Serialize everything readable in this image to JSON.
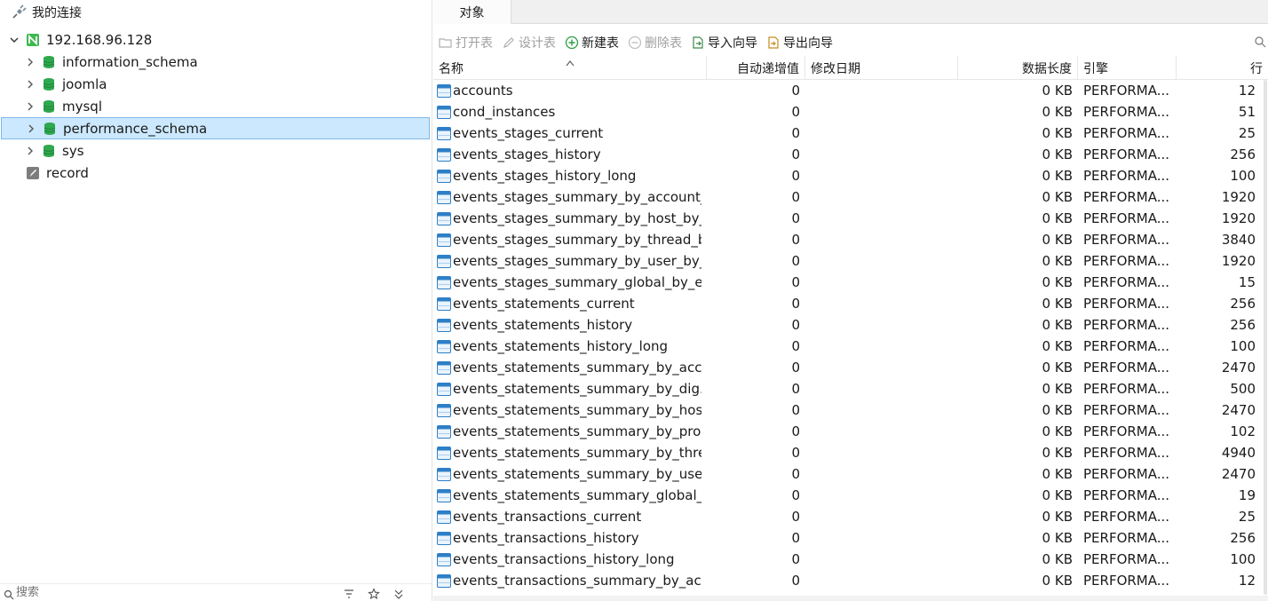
{
  "navigator": {
    "title": "我的连接",
    "connection": {
      "label": "192.168.96.128"
    },
    "databases": [
      {
        "label": "information_schema"
      },
      {
        "label": "joomla"
      },
      {
        "label": "mysql"
      },
      {
        "label": "performance_schema",
        "selected": true
      },
      {
        "label": "sys"
      }
    ],
    "other": {
      "label": "record"
    },
    "search": {
      "placeholder": "搜索"
    }
  },
  "tabs": [
    {
      "label": "对象"
    }
  ],
  "toolbar": {
    "open_table": "打开表",
    "design_table": "设计表",
    "new_table": "新建表",
    "delete_table": "删除表",
    "import_wizard": "导入向导",
    "export_wizard": "导出向导"
  },
  "columns": {
    "name": "名称",
    "auto_increment": "自动递增值",
    "modified": "修改日期",
    "data_length": "数据长度",
    "engine": "引擎",
    "rows": "行"
  },
  "rows": [
    {
      "name": "accounts",
      "auto": "0",
      "modified": "",
      "size": "0 KB",
      "engine": "PERFORMA...",
      "rows": "12"
    },
    {
      "name": "cond_instances",
      "auto": "0",
      "modified": "",
      "size": "0 KB",
      "engine": "PERFORMA...",
      "rows": "51"
    },
    {
      "name": "events_stages_current",
      "auto": "0",
      "modified": "",
      "size": "0 KB",
      "engine": "PERFORMA...",
      "rows": "25"
    },
    {
      "name": "events_stages_history",
      "auto": "0",
      "modified": "",
      "size": "0 KB",
      "engine": "PERFORMA...",
      "rows": "256"
    },
    {
      "name": "events_stages_history_long",
      "auto": "0",
      "modified": "",
      "size": "0 KB",
      "engine": "PERFORMA...",
      "rows": "100"
    },
    {
      "name": "events_stages_summary_by_account_...",
      "auto": "0",
      "modified": "",
      "size": "0 KB",
      "engine": "PERFORMA...",
      "rows": "1920"
    },
    {
      "name": "events_stages_summary_by_host_by_...",
      "auto": "0",
      "modified": "",
      "size": "0 KB",
      "engine": "PERFORMA...",
      "rows": "1920"
    },
    {
      "name": "events_stages_summary_by_thread_b...",
      "auto": "0",
      "modified": "",
      "size": "0 KB",
      "engine": "PERFORMA...",
      "rows": "3840"
    },
    {
      "name": "events_stages_summary_by_user_by_...",
      "auto": "0",
      "modified": "",
      "size": "0 KB",
      "engine": "PERFORMA...",
      "rows": "1920"
    },
    {
      "name": "events_stages_summary_global_by_e...",
      "auto": "0",
      "modified": "",
      "size": "0 KB",
      "engine": "PERFORMA...",
      "rows": "15"
    },
    {
      "name": "events_statements_current",
      "auto": "0",
      "modified": "",
      "size": "0 KB",
      "engine": "PERFORMA...",
      "rows": "256"
    },
    {
      "name": "events_statements_history",
      "auto": "0",
      "modified": "",
      "size": "0 KB",
      "engine": "PERFORMA...",
      "rows": "256"
    },
    {
      "name": "events_statements_history_long",
      "auto": "0",
      "modified": "",
      "size": "0 KB",
      "engine": "PERFORMA...",
      "rows": "100"
    },
    {
      "name": "events_statements_summary_by_acc...",
      "auto": "0",
      "modified": "",
      "size": "0 KB",
      "engine": "PERFORMA...",
      "rows": "2470"
    },
    {
      "name": "events_statements_summary_by_dig...",
      "auto": "0",
      "modified": "",
      "size": "0 KB",
      "engine": "PERFORMA...",
      "rows": "500"
    },
    {
      "name": "events_statements_summary_by_hos...",
      "auto": "0",
      "modified": "",
      "size": "0 KB",
      "engine": "PERFORMA...",
      "rows": "2470"
    },
    {
      "name": "events_statements_summary_by_pro...",
      "auto": "0",
      "modified": "",
      "size": "0 KB",
      "engine": "PERFORMA...",
      "rows": "102"
    },
    {
      "name": "events_statements_summary_by_thre...",
      "auto": "0",
      "modified": "",
      "size": "0 KB",
      "engine": "PERFORMA...",
      "rows": "4940"
    },
    {
      "name": "events_statements_summary_by_user...",
      "auto": "0",
      "modified": "",
      "size": "0 KB",
      "engine": "PERFORMA...",
      "rows": "2470"
    },
    {
      "name": "events_statements_summary_global_...",
      "auto": "0",
      "modified": "",
      "size": "0 KB",
      "engine": "PERFORMA...",
      "rows": "19"
    },
    {
      "name": "events_transactions_current",
      "auto": "0",
      "modified": "",
      "size": "0 KB",
      "engine": "PERFORMA...",
      "rows": "25"
    },
    {
      "name": "events_transactions_history",
      "auto": "0",
      "modified": "",
      "size": "0 KB",
      "engine": "PERFORMA...",
      "rows": "256"
    },
    {
      "name": "events_transactions_history_long",
      "auto": "0",
      "modified": "",
      "size": "0 KB",
      "engine": "PERFORMA...",
      "rows": "100"
    },
    {
      "name": "events_transactions_summary_by_acc...",
      "auto": "0",
      "modified": "",
      "size": "0 KB",
      "engine": "PERFORMA...",
      "rows": "12"
    }
  ]
}
